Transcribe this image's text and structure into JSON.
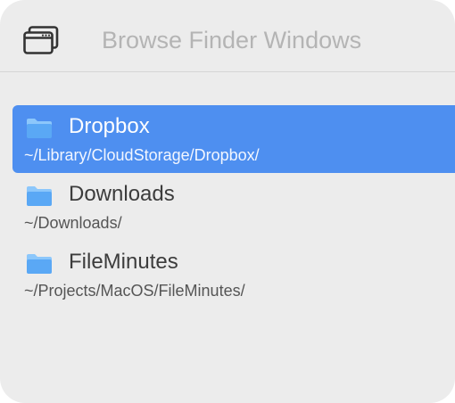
{
  "header": {
    "icon": "browser-window-icon",
    "search_placeholder": "Browse Finder Windows",
    "search_value": ""
  },
  "results": [
    {
      "name": "Dropbox",
      "path": "~/Library/CloudStorage/Dropbox/",
      "icon": "folder-icon",
      "selected": true
    },
    {
      "name": "Downloads",
      "path": "~/Downloads/",
      "icon": "folder-icon",
      "selected": false
    },
    {
      "name": "FileMinutes",
      "path": "~/Projects/MacOS/FileMinutes/",
      "icon": "folder-icon",
      "selected": false
    }
  ],
  "colors": {
    "selection": "#4e8ff0",
    "folder": "#5aa8f5",
    "background": "#ececec"
  }
}
